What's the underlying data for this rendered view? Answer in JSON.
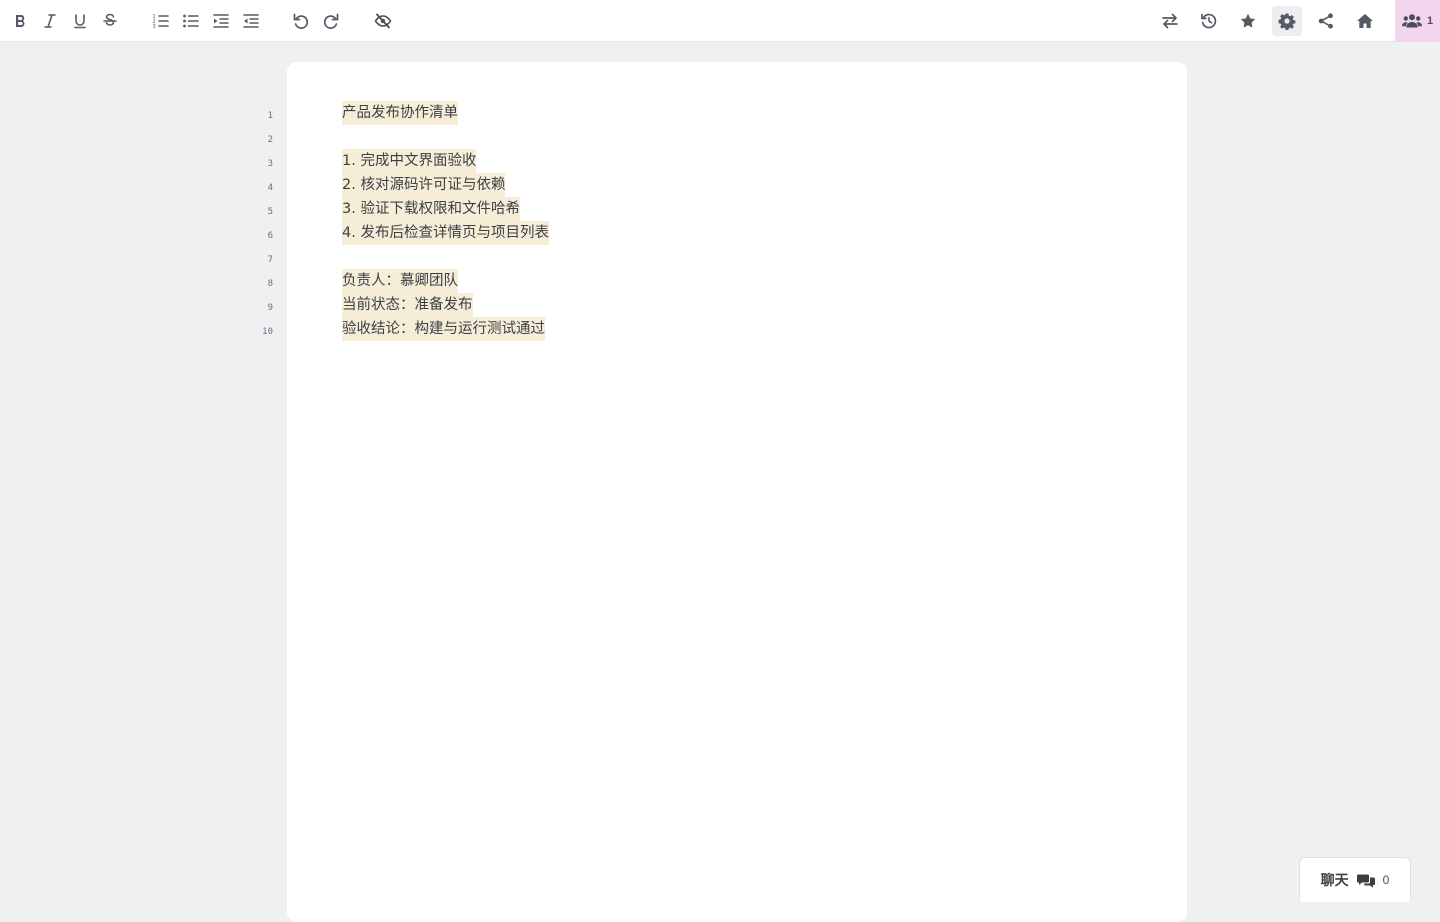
{
  "toolbar": {
    "left_icons": [
      "bold-icon",
      "italic-icon",
      "underline-icon",
      "strikethrough-icon",
      "ordered-list-icon",
      "bullet-list-icon",
      "indent-icon",
      "outdent-icon",
      "undo-icon",
      "redo-icon",
      "hide-authorship-icon"
    ],
    "right_icons": [
      "swap-icon",
      "history-icon",
      "star-icon",
      "gear-icon",
      "share-icon",
      "home-icon",
      "users-icon"
    ],
    "users_count": "1"
  },
  "editor": {
    "line_numbers": [
      "1",
      "2",
      "3",
      "4",
      "5",
      "6",
      "7",
      "8",
      "9",
      "10"
    ],
    "lines": [
      "产品发布协作清单",
      "",
      "1. 完成中文界面验收",
      "2. 核对源码许可证与依赖",
      "3. 验证下载权限和文件哈希",
      "4. 发布后检查详情页与项目列表",
      "",
      "负责人：慕卿团队",
      "当前状态：准备发布",
      "验收结论：构建与运行测试通过"
    ],
    "highlight_color": "#f5edd6"
  },
  "chat": {
    "label": "聊天",
    "count": "0"
  },
  "colors": {
    "background": "#eef0f2",
    "users_badge": "#f3d6ee"
  }
}
